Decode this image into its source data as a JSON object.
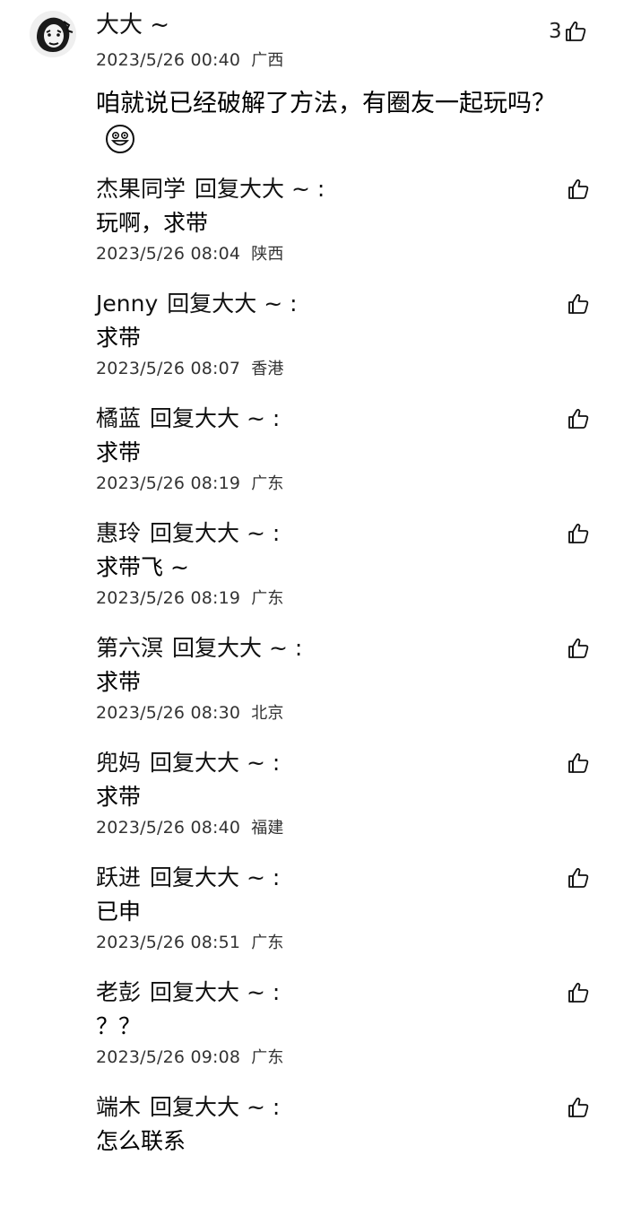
{
  "main": {
    "author": "大大 ~",
    "time": "2023/5/26 00:40",
    "location": "广西",
    "content": "咱就说已经破解了方法，有圈友一起玩吗？",
    "emoji": "smiley-emoji",
    "likes": "3"
  },
  "reply_word": "回复",
  "reply_target": "大大 ~ :",
  "replies": [
    {
      "user": "杰果同学",
      "text": "玩啊，求带",
      "time": "2023/5/26 08:04",
      "location": "陕西"
    },
    {
      "user": "Jenny",
      "text": "求带",
      "time": "2023/5/26 08:07",
      "location": "香港"
    },
    {
      "user": "橘蓝",
      "text": "求带",
      "time": "2023/5/26 08:19",
      "location": "广东"
    },
    {
      "user": "惠玲",
      "text": "求带飞 ~",
      "time": "2023/5/26 08:19",
      "location": "广东"
    },
    {
      "user": "第六溟",
      "text": "求带",
      "time": "2023/5/26 08:30",
      "location": "北京"
    },
    {
      "user": "兜妈",
      "text": "求带",
      "time": "2023/5/26 08:40",
      "location": "福建"
    },
    {
      "user": "跃进",
      "text": "已申",
      "time": "2023/5/26 08:51",
      "location": "广东"
    },
    {
      "user": "老彭",
      "text": "？？",
      "time": "2023/5/26 09:08",
      "location": "广东"
    },
    {
      "user": "端木",
      "text": "怎么联系",
      "time": "",
      "location": ""
    }
  ],
  "icons": {
    "like": "thumbs-up-icon",
    "avatar": "avatar-image"
  }
}
